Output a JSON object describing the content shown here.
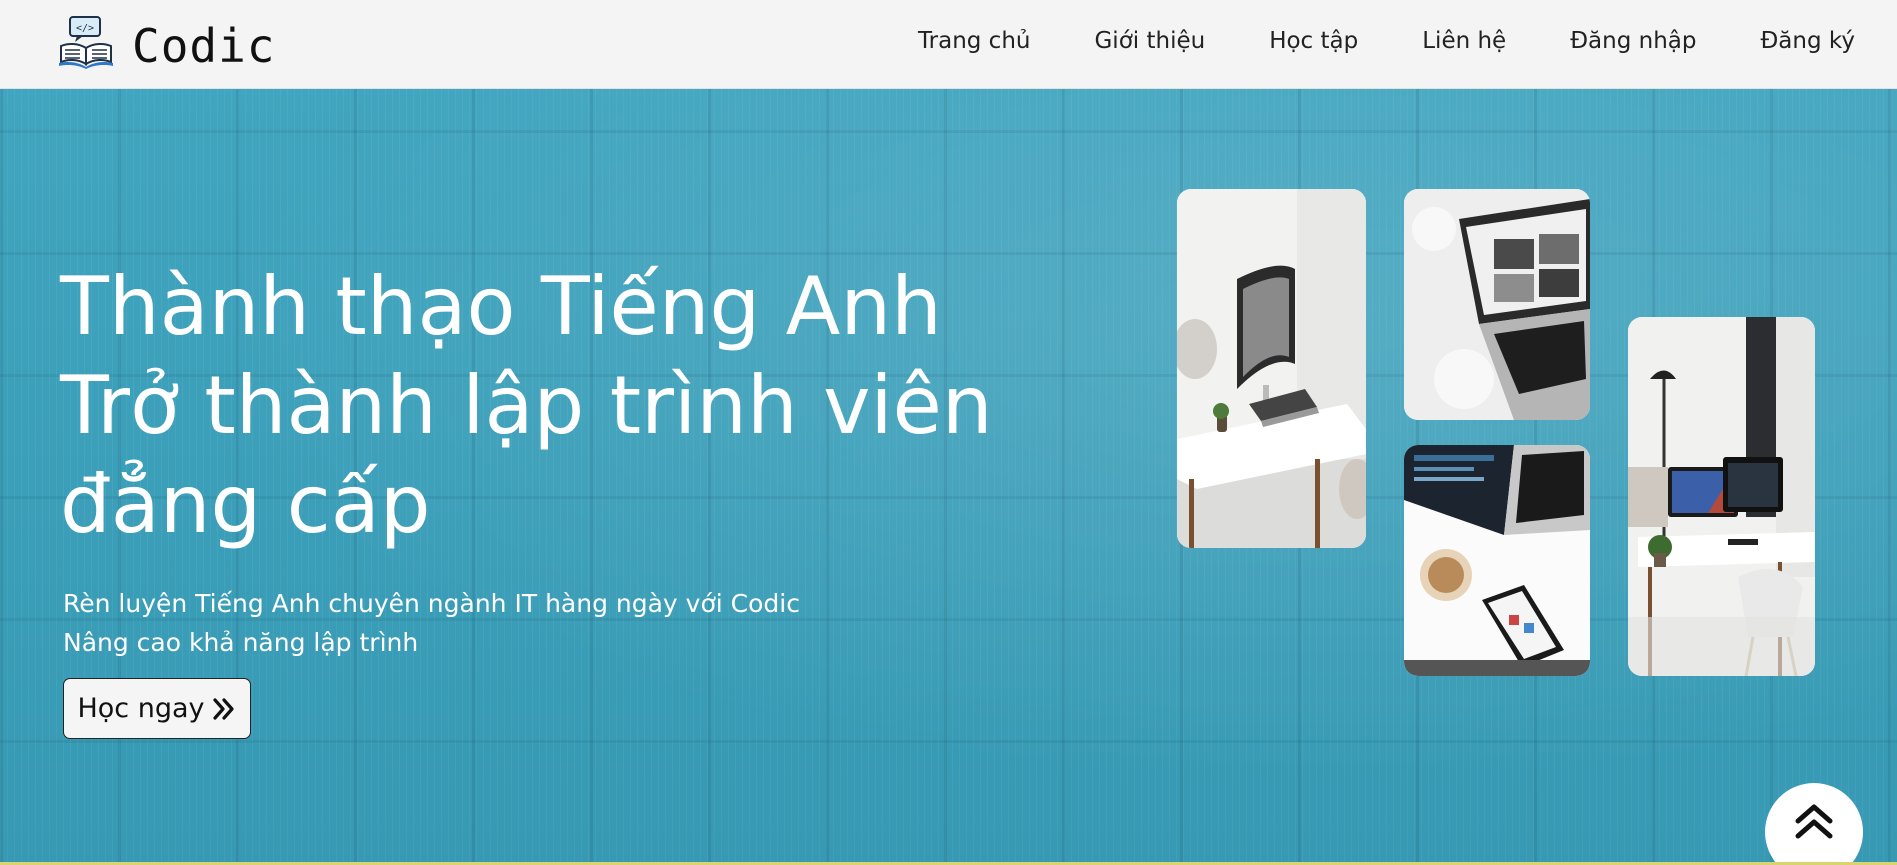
{
  "header": {
    "brand": "Codic",
    "nav": [
      "Trang chủ",
      "Giới thiệu",
      "Học tập",
      "Liên hệ",
      "Đăng nhập",
      "Đăng ký"
    ]
  },
  "hero": {
    "headline": [
      "Thành thạo Tiếng Anh",
      "Trở thành lập trình viên",
      "đẳng cấp"
    ],
    "subtext": [
      "Rèn luyện Tiếng Anh chuyên ngành IT hàng ngày với Codic",
      "Nâng cao khả năng lập trình"
    ],
    "cta_label": "Học ngay",
    "cta_icon": "double-chevron-right-icon",
    "photos": [
      "desk-monitor-photo",
      "laptop-on-rug-photo",
      "laptop-coffee-phone-photo",
      "desk-monitors-chair-photo"
    ]
  },
  "back_to_top": {
    "icon": "double-chevron-up-icon"
  },
  "colors": {
    "hero_background": "#3b9eb8",
    "text_light": "#ffffff",
    "header_background": "#f4f4f4"
  }
}
